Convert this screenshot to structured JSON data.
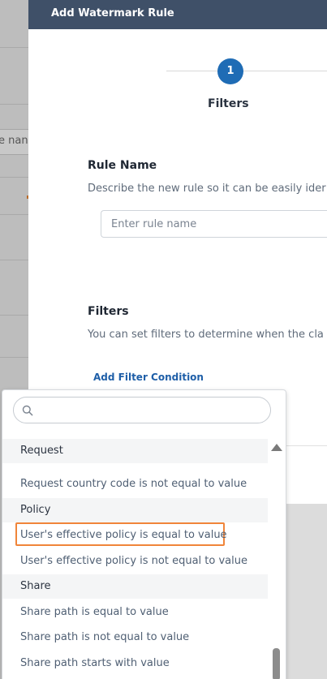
{
  "background": {
    "input_partial_text": "e nan"
  },
  "modal": {
    "title": "Add Watermark Rule",
    "stepper": {
      "step_number": "1",
      "step_label": "Filters"
    },
    "rule_name": {
      "title": "Rule Name",
      "description": "Describe the new rule so it can be easily ider",
      "placeholder": "Enter rule name",
      "value": ""
    },
    "filters": {
      "title": "Filters",
      "description": "You can set filters to determine when the cla",
      "add_filter_label": "Add Filter Condition"
    }
  },
  "dropdown": {
    "search": {
      "placeholder": "",
      "value": ""
    },
    "groups": [
      {
        "label": "Request",
        "options": [
          "Request country code is not equal to value"
        ]
      },
      {
        "label": "Policy",
        "options": [
          "User's effective policy is equal to value",
          "User's effective policy is not equal to value"
        ]
      },
      {
        "label": "Share",
        "options": [
          "Share path is equal to value",
          "Share path is not equal to value",
          "Share path starts with value"
        ]
      }
    ],
    "highlighted_option": "User's effective policy is equal to value",
    "colors": {
      "highlight_border": "#f0853a",
      "link": "#1f5fa8",
      "header_bg": "#3f5068",
      "step_circle": "#1f6cb5"
    }
  }
}
